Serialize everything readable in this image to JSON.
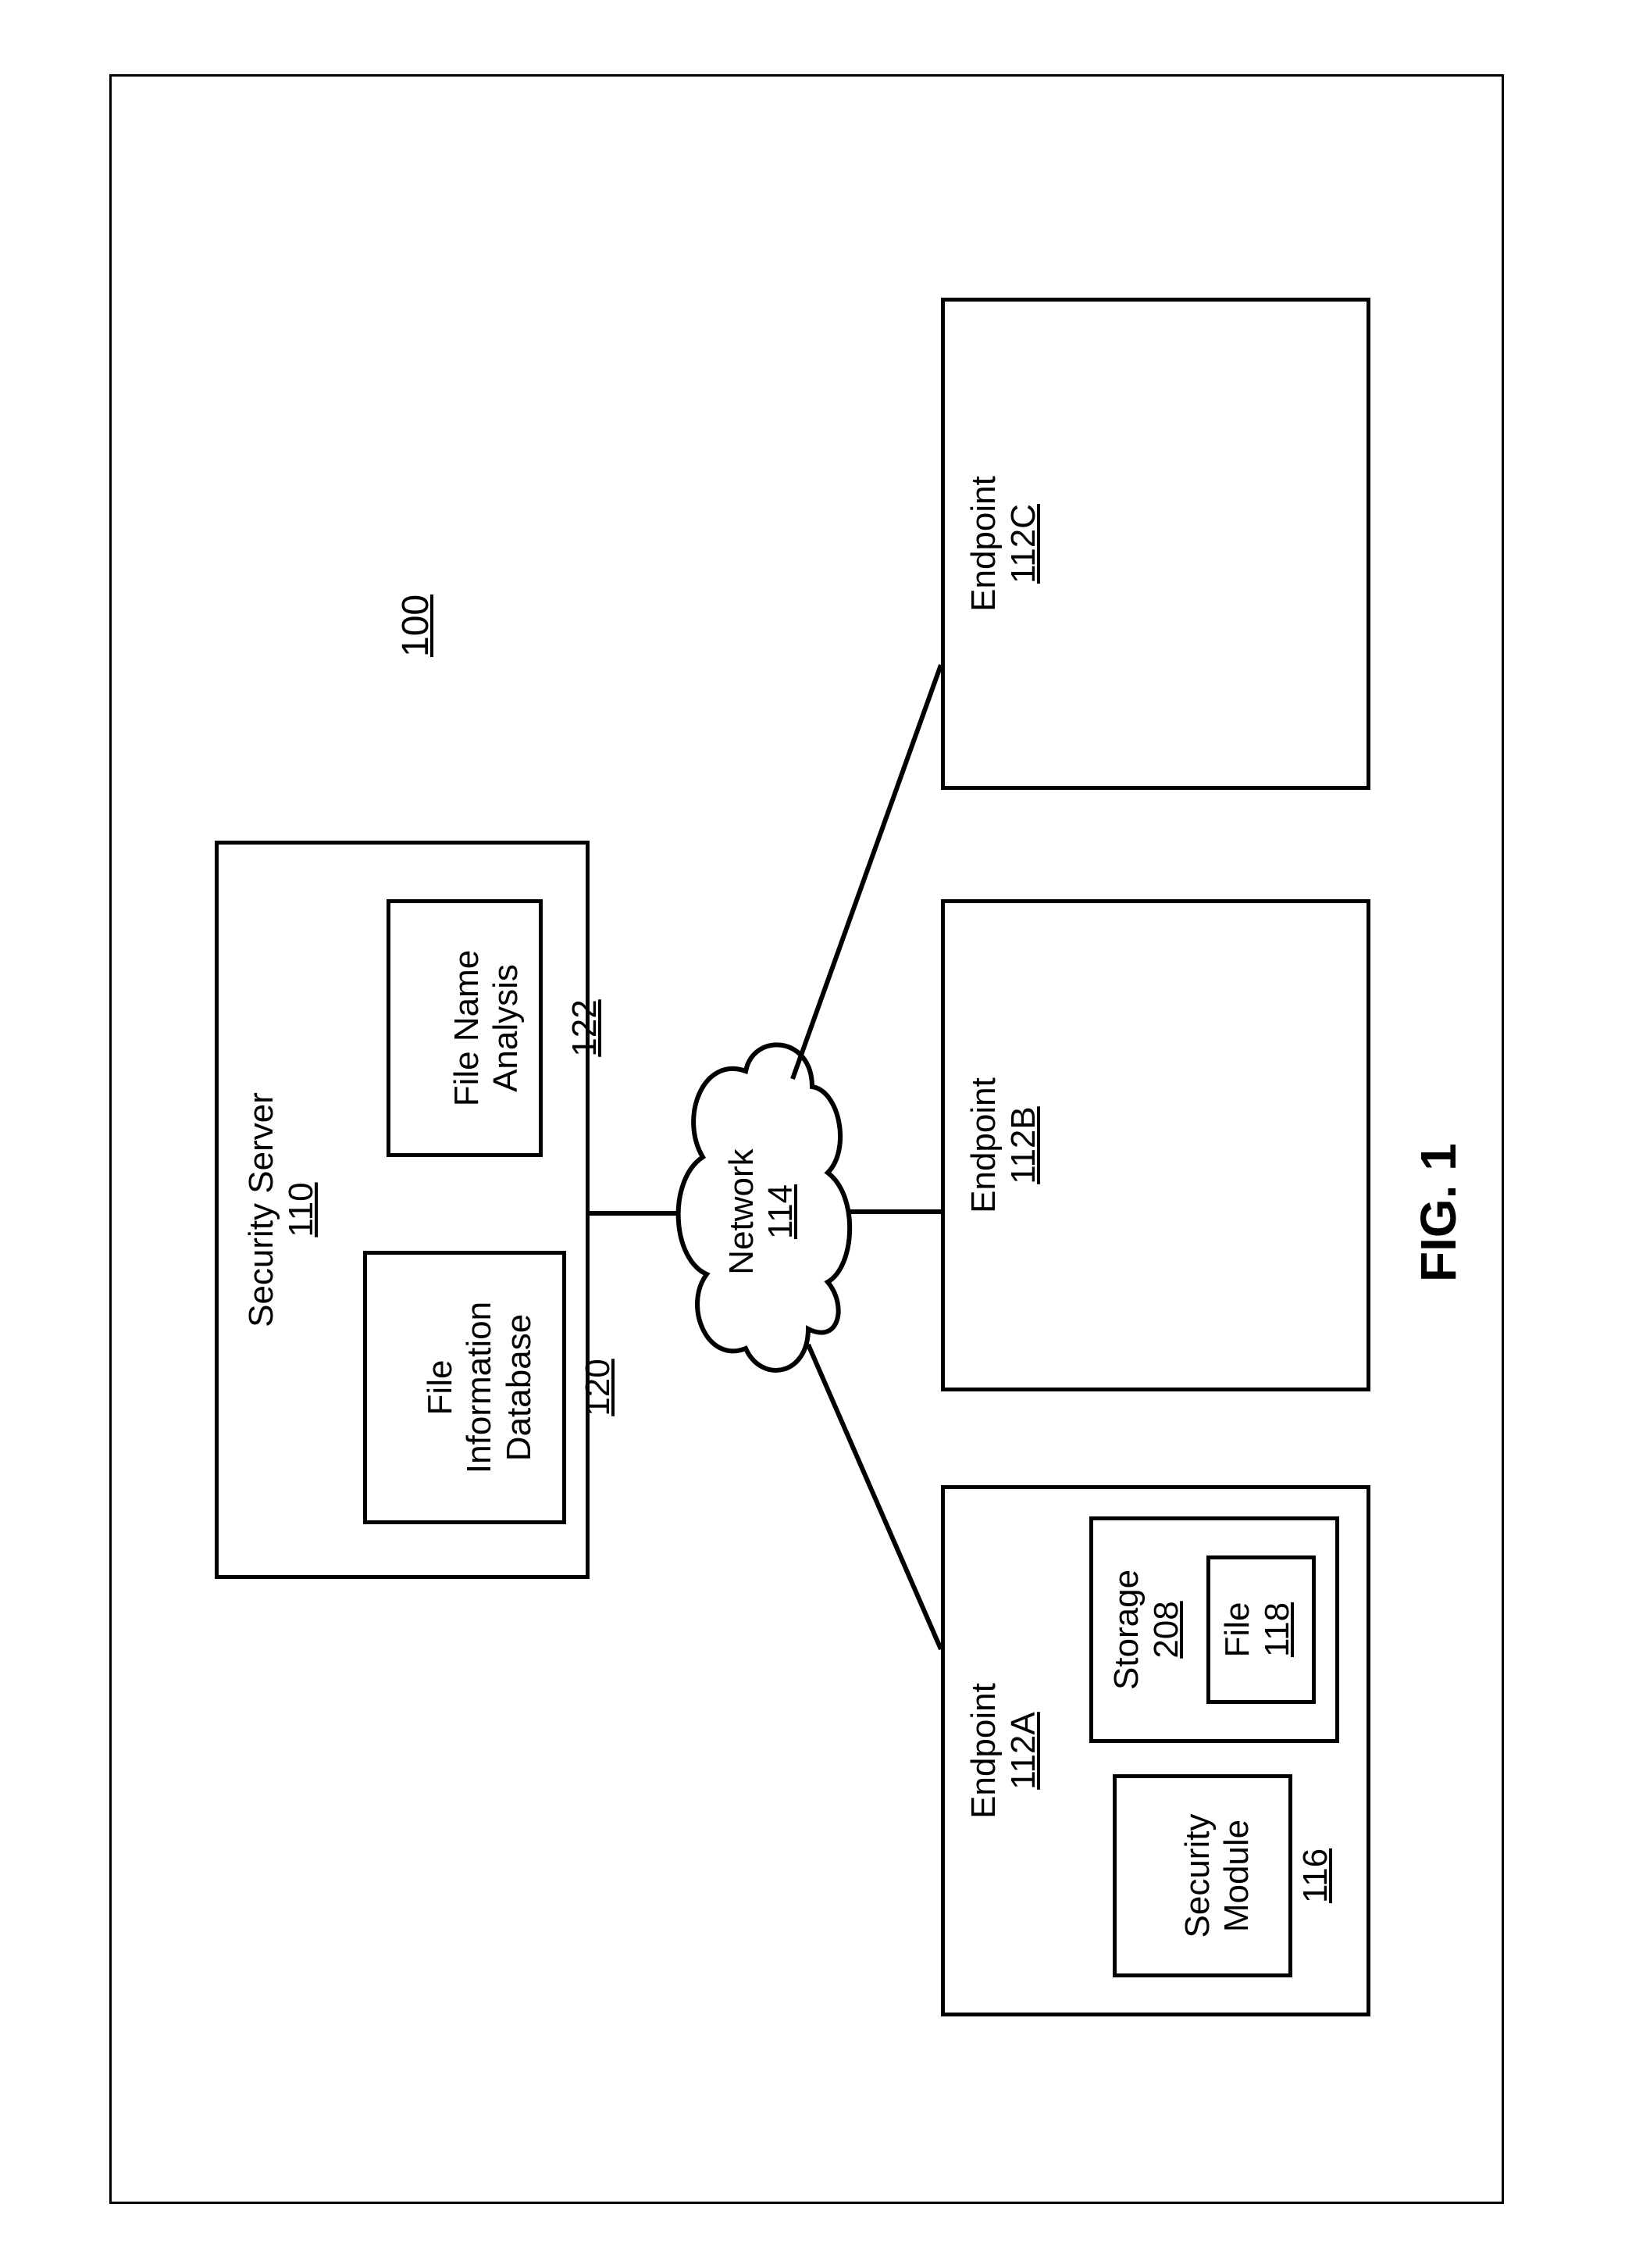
{
  "figure_caption": "FIG. 1",
  "system_ref": "100",
  "security_server": {
    "name": "Security Server",
    "ref": "110"
  },
  "file_info_db": {
    "name": "File\nInformation\nDatabase",
    "ref": "120"
  },
  "file_name_analysis": {
    "name": "File Name\nAnalysis",
    "ref": "122"
  },
  "network": {
    "name": "Network",
    "ref": "114"
  },
  "endpoint_a": {
    "name": "Endpoint",
    "ref": "112A"
  },
  "endpoint_b": {
    "name": "Endpoint",
    "ref": "112B"
  },
  "endpoint_c": {
    "name": "Endpoint",
    "ref": "112C"
  },
  "security_module": {
    "name": "Security\nModule",
    "ref": "116"
  },
  "storage": {
    "name": "Storage",
    "ref": "208"
  },
  "file": {
    "name": "File",
    "ref": "118"
  }
}
